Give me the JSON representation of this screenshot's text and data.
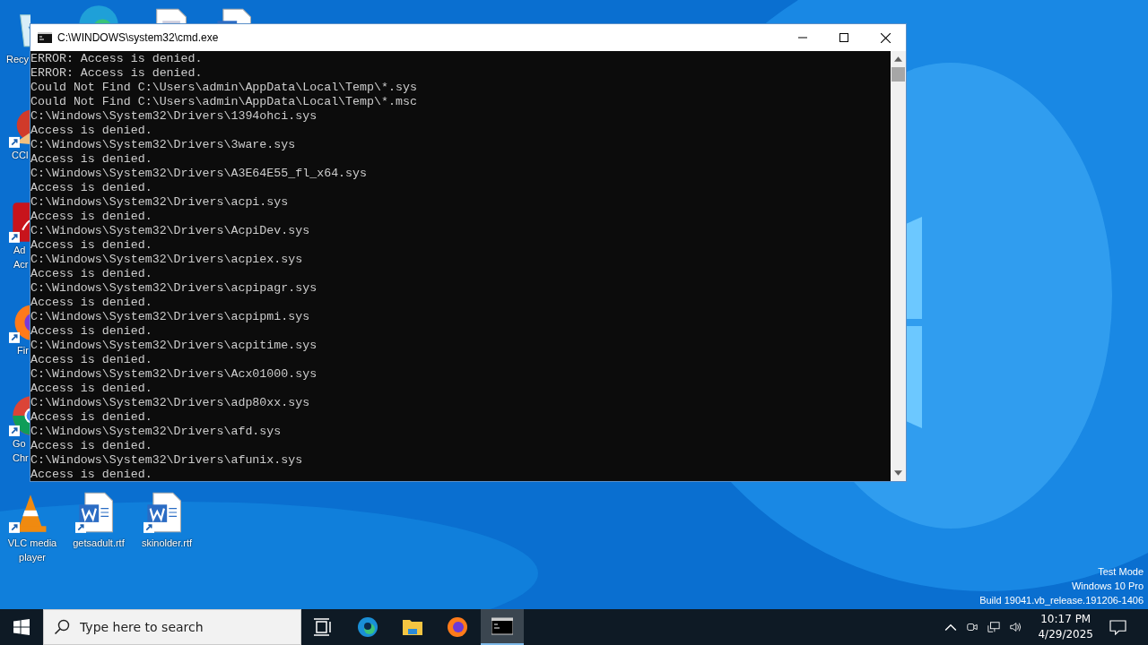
{
  "desktop": {
    "icons": [
      {
        "kind": "recycle",
        "label": [
          "Recy"
        ]
      },
      {
        "kind": "edge"
      },
      {
        "kind": "doc"
      },
      {
        "kind": "word"
      },
      {
        "kind": "ccleaner",
        "label": [
          "CCl"
        ]
      },
      {
        "kind": "acrobat",
        "label": [
          "Ad",
          "Acr"
        ]
      },
      {
        "kind": "firefox",
        "label": [
          "Fir"
        ]
      },
      {
        "kind": "chrome",
        "label": [
          "Go",
          "Chr"
        ]
      },
      {
        "kind": "vlc",
        "label": [
          "VLC media",
          "player"
        ]
      },
      {
        "kind": "word",
        "label": [
          "getsadult.rtf"
        ]
      },
      {
        "kind": "word",
        "label": [
          "skinolder.rtf"
        ]
      }
    ],
    "os_info": [
      "Test Mode",
      "Windows 10 Pro",
      "Build 19041.vb_release.191206-1406"
    ]
  },
  "window": {
    "title": "C:\\WINDOWS\\system32\\cmd.exe",
    "lines": [
      "ERROR: Access is denied.",
      "ERROR: Access is denied.",
      "Could Not Find C:\\Users\\admin\\AppData\\Local\\Temp\\*.sys",
      "Could Not Find C:\\Users\\admin\\AppData\\Local\\Temp\\*.msc",
      "C:\\Windows\\System32\\Drivers\\1394ohci.sys",
      "Access is denied.",
      "C:\\Windows\\System32\\Drivers\\3ware.sys",
      "Access is denied.",
      "C:\\Windows\\System32\\Drivers\\A3E64E55_fl_x64.sys",
      "Access is denied.",
      "C:\\Windows\\System32\\Drivers\\acpi.sys",
      "Access is denied.",
      "C:\\Windows\\System32\\Drivers\\AcpiDev.sys",
      "Access is denied.",
      "C:\\Windows\\System32\\Drivers\\acpiex.sys",
      "Access is denied.",
      "C:\\Windows\\System32\\Drivers\\acpipagr.sys",
      "Access is denied.",
      "C:\\Windows\\System32\\Drivers\\acpipmi.sys",
      "Access is denied.",
      "C:\\Windows\\System32\\Drivers\\acpitime.sys",
      "Access is denied.",
      "C:\\Windows\\System32\\Drivers\\Acx01000.sys",
      "Access is denied.",
      "C:\\Windows\\System32\\Drivers\\adp80xx.sys",
      "Access is denied.",
      "C:\\Windows\\System32\\Drivers\\afd.sys",
      "Access is denied.",
      "C:\\Windows\\System32\\Drivers\\afunix.sys",
      "Access is denied."
    ]
  },
  "taskbar": {
    "search": {
      "placeholder": "Type here to search"
    },
    "apps": [
      {
        "kind": "taskview",
        "selected": false
      },
      {
        "kind": "edge",
        "selected": false
      },
      {
        "kind": "explorer",
        "selected": false
      },
      {
        "kind": "firefox",
        "selected": false
      },
      {
        "kind": "cmd",
        "selected": true
      }
    ],
    "clock": {
      "time": "10:17 PM",
      "date": "4/29/2025"
    }
  }
}
